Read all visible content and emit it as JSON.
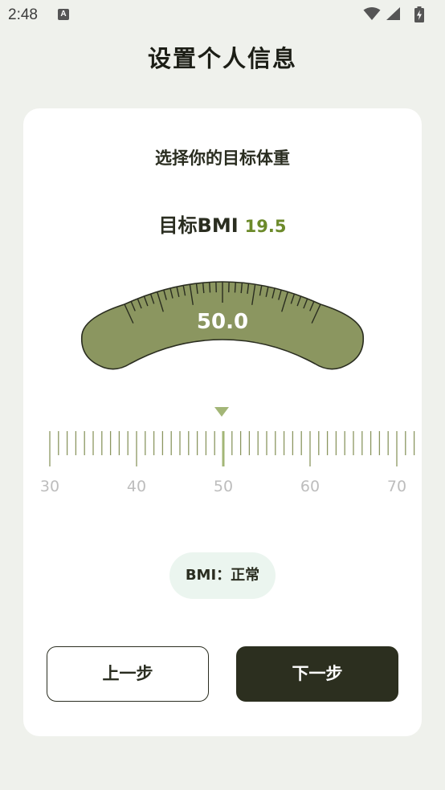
{
  "status_bar": {
    "time": "2:48",
    "notification_icon": "A"
  },
  "page": {
    "title": "设置个人信息"
  },
  "card": {
    "subtitle": "选择你的目标体重",
    "bmi_label": "目标BMI",
    "bmi_value": "19.5",
    "weight_display": "50.0",
    "ruler": {
      "min": 30,
      "max": 70,
      "step": 1,
      "major_step": 10,
      "selected": 50,
      "labels": [
        "30",
        "40",
        "50",
        "60",
        "70"
      ]
    },
    "bmi_status": "BMI：正常",
    "prev_button": "上一步",
    "next_button": "下一步"
  },
  "colors": {
    "accent": "#8b9660",
    "accent_light": "#a3b677",
    "bmi_value": "#6c8a2a",
    "dark": "#2c2f1f",
    "background": "#eff1ec",
    "pill": "#ebf5ef"
  }
}
